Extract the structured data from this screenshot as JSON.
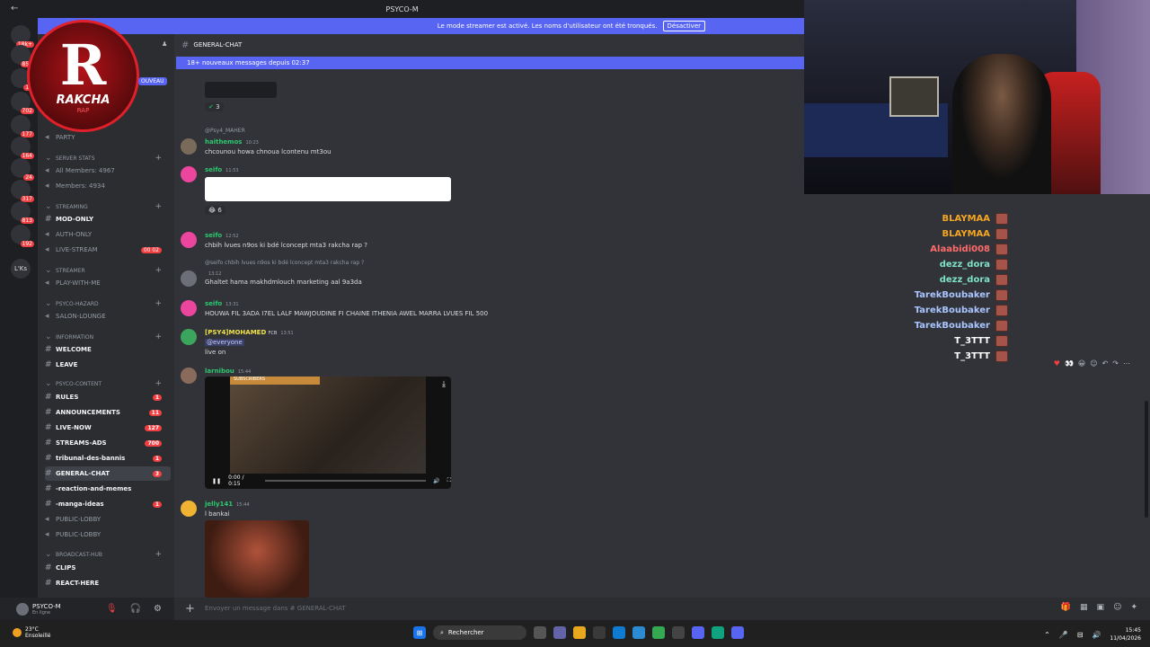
{
  "window": {
    "title": "PSYCO-M"
  },
  "banner": {
    "text": "Le mode streamer est activé. Les noms d'utilisateur ont été tronqués.",
    "button": "Désactiver"
  },
  "servers": [
    {
      "label": "",
      "badge": "18k+"
    },
    {
      "label": "",
      "badge": "859"
    },
    {
      "label": "",
      "badge": "17"
    },
    {
      "label": "",
      "badge": "702"
    },
    {
      "label": "",
      "badge": "177"
    },
    {
      "label": "",
      "badge": "164"
    },
    {
      "label": "",
      "badge": "24"
    },
    {
      "label": "",
      "badge": "317"
    },
    {
      "label": "",
      "badge": "813"
    },
    {
      "label": "",
      "badge": "192"
    },
    {
      "label": "L'Ks",
      "badge": ""
    }
  ],
  "logo": {
    "letter": "R",
    "name": "RAKCHA",
    "sub": "RAP"
  },
  "new_pill": "OUVEAU",
  "channels": [
    {
      "label": "PARTY",
      "kind": "voice"
    },
    {
      "label": "SERVER STATS",
      "kind": "category"
    },
    {
      "label": "All Members: 4967",
      "kind": "voice"
    },
    {
      "label": "Members: 4934",
      "kind": "voice"
    },
    {
      "label": "STREAMING",
      "kind": "category"
    },
    {
      "label": "MOD-ONLY",
      "kind": "text",
      "bold": true
    },
    {
      "label": "AUTH-ONLY",
      "kind": "voice"
    },
    {
      "label": "LIVE-STREAM",
      "kind": "voice",
      "count": "00 02"
    },
    {
      "label": "STREAMER",
      "kind": "category"
    },
    {
      "label": "PLAY-WITH-ME",
      "kind": "voice"
    },
    {
      "label": "PSYCO-HAZARD",
      "kind": "category"
    },
    {
      "label": "SALON-LOUNGE",
      "kind": "voice"
    },
    {
      "label": "INFORMATION",
      "kind": "category"
    },
    {
      "label": "WELCOME",
      "kind": "text",
      "bold": true
    },
    {
      "label": "LEAVE",
      "kind": "text",
      "bold": true
    },
    {
      "label": "PSYCO-CONTENT",
      "kind": "category"
    },
    {
      "label": "RULES",
      "kind": "text",
      "bold": true,
      "count": "1"
    },
    {
      "label": "ANNOUNCEMENTS",
      "kind": "text",
      "bold": true,
      "count": "11"
    },
    {
      "label": "LIVE-NOW",
      "kind": "text",
      "bold": true,
      "count": "127"
    },
    {
      "label": "STREAMS-ADS",
      "kind": "text",
      "bold": true,
      "count": "700"
    },
    {
      "label": "tribunal-des-bannis",
      "kind": "text",
      "bold": true,
      "count": "1"
    },
    {
      "label": "GENERAL-CHAT",
      "kind": "text",
      "bold": true,
      "count": "3",
      "active": true
    },
    {
      "label": "-reaction-and-memes",
      "kind": "text",
      "bold": true
    },
    {
      "label": "-manga-ideas",
      "kind": "text",
      "bold": true,
      "count": "1"
    },
    {
      "label": "PUBLIC-LOBBY",
      "kind": "voice"
    },
    {
      "label": "PUBLIC-LOBBY",
      "kind": "voice"
    },
    {
      "label": "BROADCAST-HUB",
      "kind": "category"
    },
    {
      "label": "CLIPS",
      "kind": "text",
      "bold": true
    },
    {
      "label": "REACT-HERE",
      "kind": "text",
      "bold": true
    }
  ],
  "user": {
    "name": "PSYCO-M",
    "status": "En ligne"
  },
  "chat": {
    "channel": "GENERAL-CHAT",
    "new_messages": "18+ nouveaux messages depuis 02:37",
    "reaction1": "3",
    "reaction2": "6",
    "messages": [
      {
        "user": "haithemos",
        "time": "10:23",
        "text": "chcounou howa chnoua lcontenu mt3ou",
        "color": "#2dc770",
        "reply": "@Psy4_MAHER"
      },
      {
        "user": "seifo",
        "time": "11:53",
        "text": "",
        "color": "#2dc770"
      },
      {
        "user": "seifo",
        "time": "12:52",
        "text": "chbih lvues n9os ki bdé lconcept mta3 rakcha rap ?",
        "color": "#2dc770"
      },
      {
        "user": "",
        "time": "13:12",
        "text": "Ghaltet hama makhdmlouch marketing aal 9a3da",
        "color": "#dbdee1",
        "reply": "@seifo chbih lvues n9os ki bdé lconcept mta3 rakcha rap ?"
      },
      {
        "user": "seifo",
        "time": "13:31",
        "text": "HOUWA FIL 3ADA I7EL LALF MAWJOUDINE FI CHAINE ITHENIA AWEL MARRA LVUES FIL 500",
        "color": "#2dc770"
      },
      {
        "user": "[PSY4]MOHAMED",
        "time": "13:51",
        "text": "live on",
        "color": "#f0e14a",
        "mention": "@everyone",
        "tag": "FCB"
      },
      {
        "user": "larnibou",
        "time": "15:44",
        "text": "",
        "color": "#2dc770"
      },
      {
        "user": "jelly141",
        "time": "15:44",
        "text": "l bankai",
        "color": "#2dc770"
      }
    ],
    "video": {
      "time": "0:00 / 0:15",
      "overlay": "SUBSCRIBERS"
    },
    "composer_placeholder": "Envoyer un message dans #",
    "composer_channel": "GENERAL-CHAT"
  },
  "stream_chat": [
    {
      "name": "BLAYMAA",
      "color": "#f5a623"
    },
    {
      "name": "BLAYMAA",
      "color": "#f5a623"
    },
    {
      "name": "Alaabidi008",
      "color": "#ff6b6b"
    },
    {
      "name": "dezz_dora",
      "color": "#7fe3c8"
    },
    {
      "name": "dezz_dora",
      "color": "#7fe3c8"
    },
    {
      "name": "TarekBoubaker",
      "color": "#a9c4ff"
    },
    {
      "name": "TarekBoubaker",
      "color": "#a9c4ff"
    },
    {
      "name": "TarekBoubaker",
      "color": "#a9c4ff"
    },
    {
      "name": "T_3TTT",
      "color": "#ffffff"
    },
    {
      "name": "T_3TTT",
      "color": "#ffffff"
    }
  ],
  "taskbar": {
    "weather_temp": "23°C",
    "weather_desc": "Ensoleillé",
    "search": "Rechercher",
    "time": "15:45",
    "date": "11/04/2026"
  }
}
